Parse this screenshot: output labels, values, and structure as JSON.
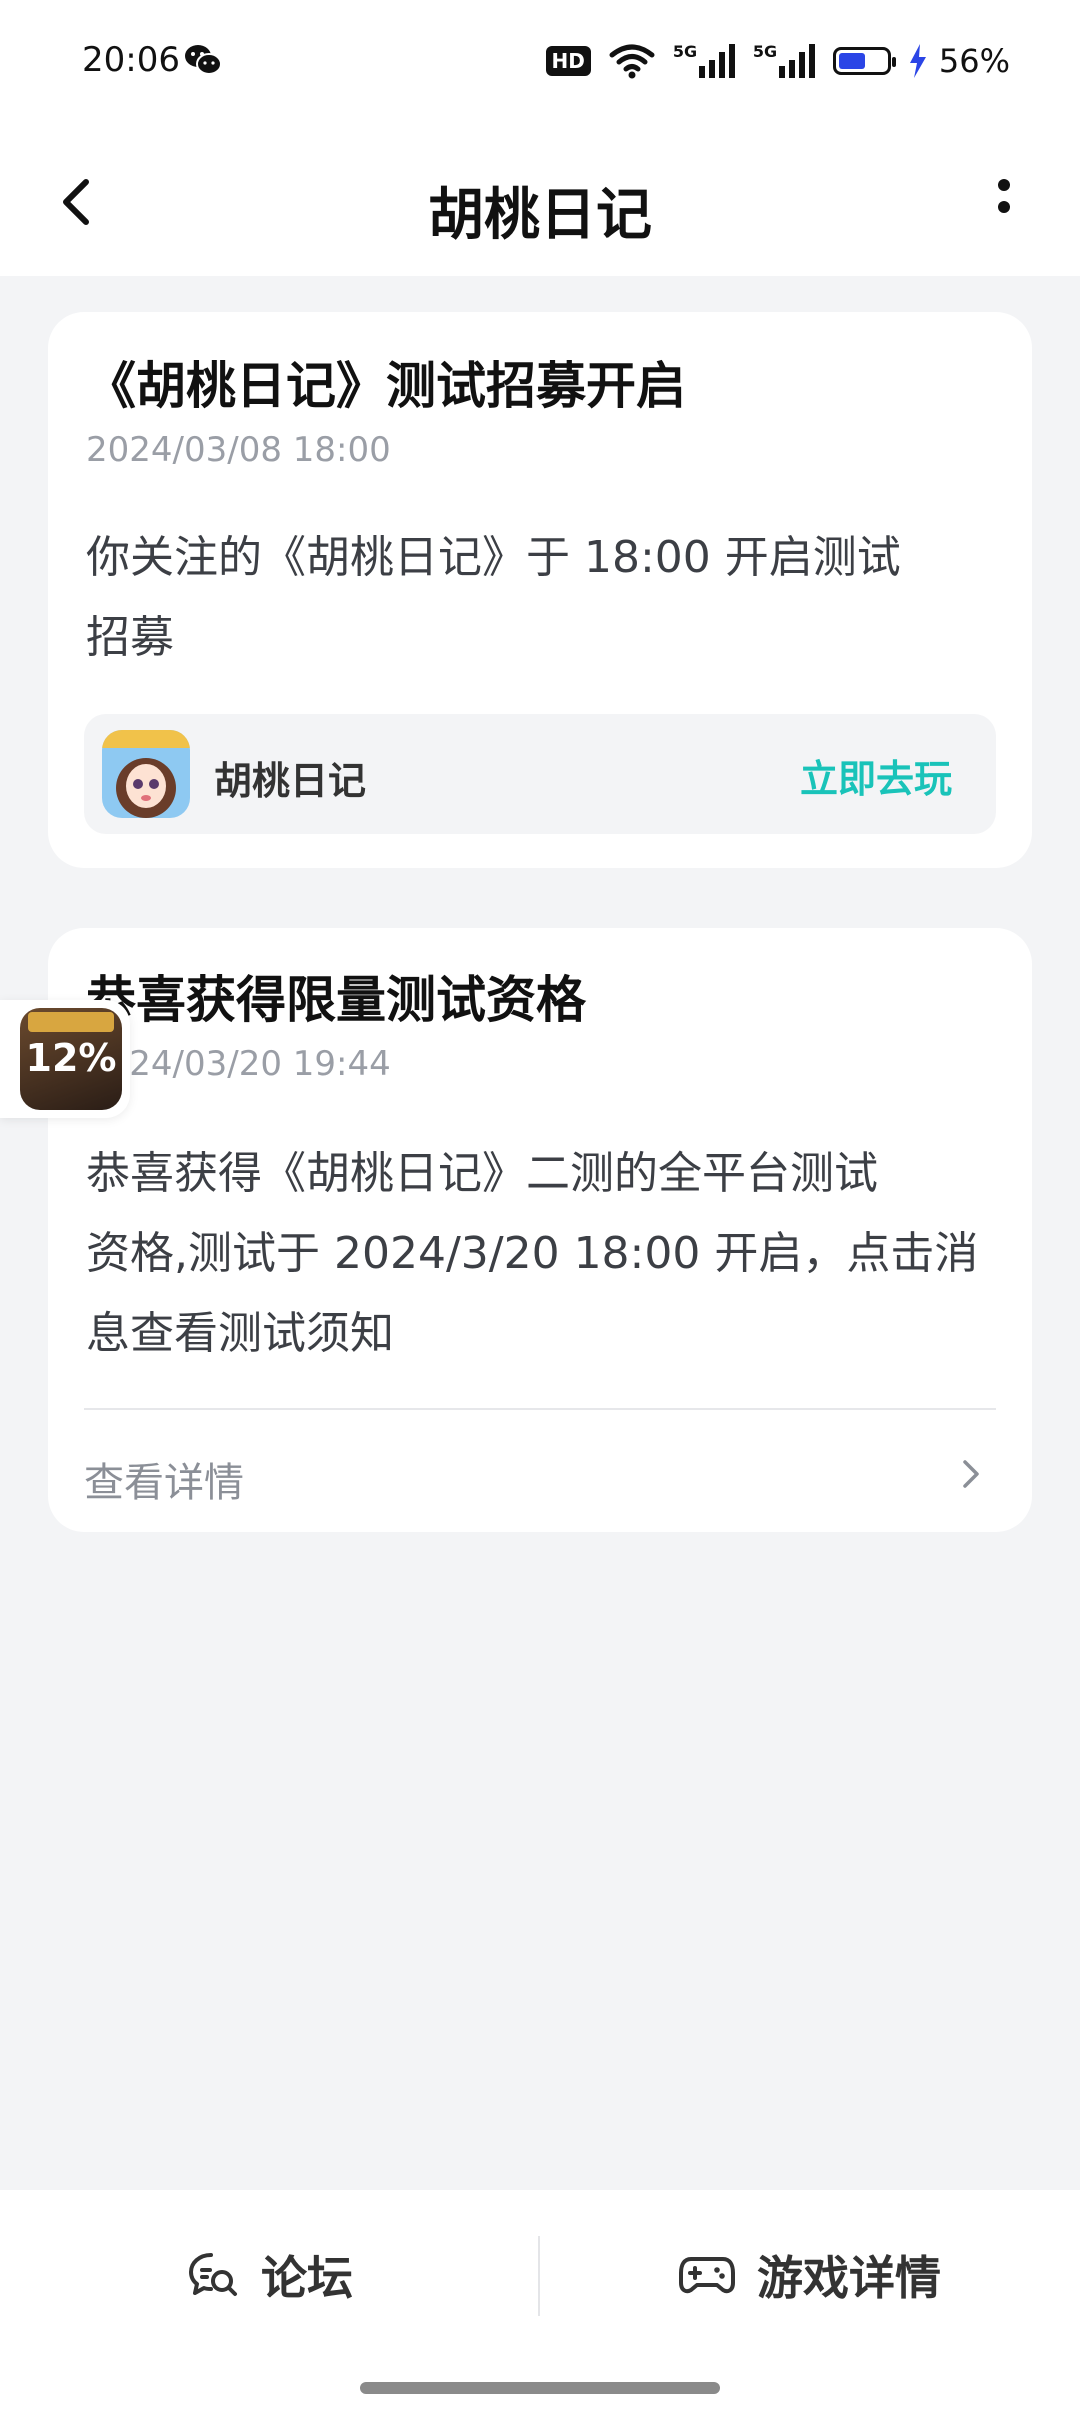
{
  "status_bar": {
    "time": "20:06",
    "hd_label": "HD",
    "signal1_label": "5G",
    "signal2_label": "5G",
    "battery_level": 0.56,
    "battery_text": "56%",
    "battery_fill_color": "#2b45e6",
    "icons": [
      "wechat-icon",
      "wifi-icon",
      "signal-icon",
      "battery-icon",
      "charging-icon"
    ]
  },
  "header": {
    "title": "胡桃日记",
    "back_icon": "chevron-left-icon",
    "more_icon": "more-vertical-icon"
  },
  "cards": [
    {
      "title": "《胡桃日记》测试招募开启",
      "date": "2024/03/08 18:00",
      "body_line1": "你关注的《胡桃日记》于 18:00 开启测试",
      "body_line2": "招募",
      "game_name": "胡桃日记",
      "action_label": "立即去玩",
      "action_color": "#19c3b9"
    },
    {
      "title": "恭喜获得限量测试资格",
      "date": "2024/03/20 19:44",
      "body_line1": "恭喜获得《胡桃日记》二测的全平台测试",
      "body_line2": "资格,测试于 2024/3/20 18:00 开启，点击消",
      "body_line3": "息查看测试须知",
      "detail_label": "查看详情"
    }
  ],
  "floating_download": {
    "progress_text": "12%",
    "progress": 0.12
  },
  "bottom_bar": {
    "forum_label": "论坛",
    "game_detail_label": "游戏详情",
    "forum_icon": "chat-search-icon",
    "game_icon": "gamepad-icon"
  }
}
